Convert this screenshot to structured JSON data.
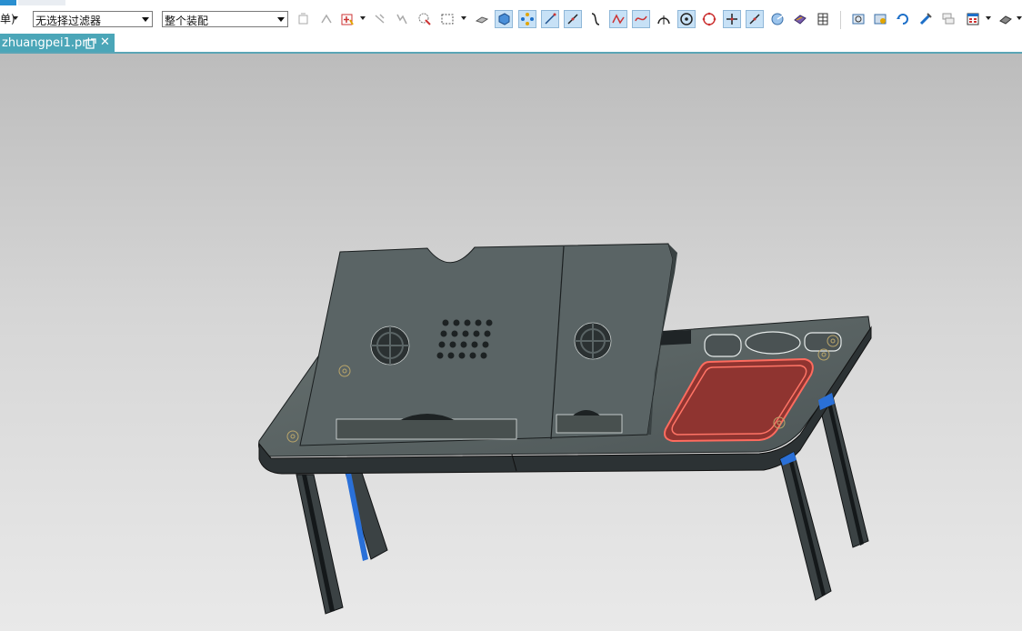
{
  "toolbar": {
    "menu_stub": "单)",
    "filter_select": {
      "value": "无选择过滤器"
    },
    "scope_select": {
      "value": "整个装配"
    }
  },
  "tab": {
    "filename": "zhuangpei1.prt",
    "close_glyph": "✕"
  },
  "icons": [
    "feature-select-icon",
    "snap-icon",
    "add-selection-icon",
    "point-icon",
    "multi-point-icon",
    "lasso-select-icon",
    "rectangle-select-icon",
    "solid-body-icon",
    "sheet-body-icon",
    "component-icon",
    "edge-icon",
    "line-icon",
    "curve-icon",
    "polyline-icon",
    "spline-icon",
    "arc-center-icon",
    "circle-center-icon",
    "circle-quadrant-icon",
    "intersection-icon",
    "line-midpoint-icon",
    "view-orient-icon",
    "shaded-view-icon",
    "grid-icon",
    "fit-view-icon",
    "render-icon",
    "rotate-icon",
    "pan-icon",
    "layers-icon",
    "window-layout-icon",
    "display-mode-icon"
  ],
  "colors": {
    "accent": "#4ba6b8",
    "model_body": "#5b6466",
    "highlight": "#d9534f"
  }
}
